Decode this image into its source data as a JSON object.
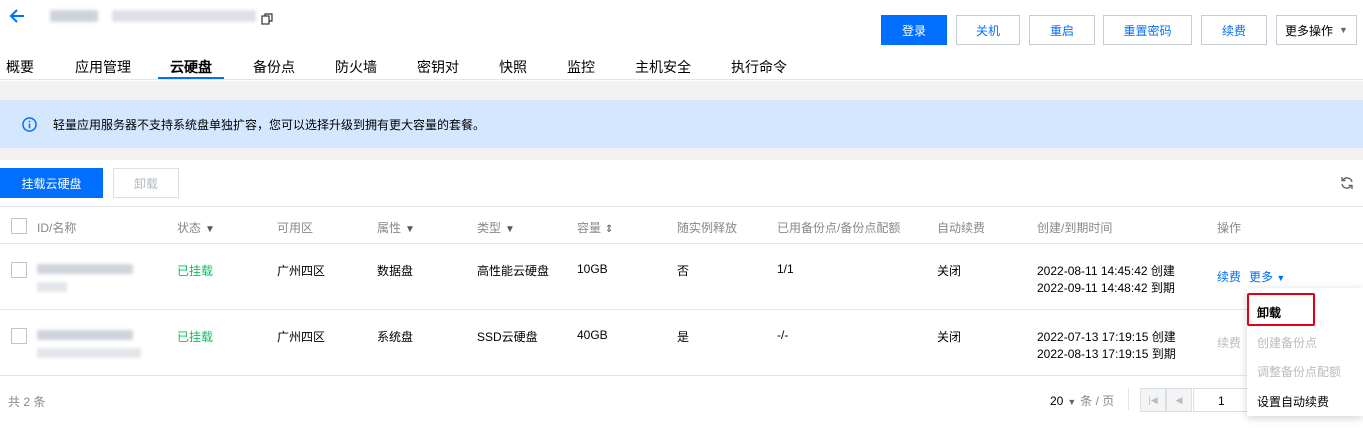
{
  "header": {
    "instance_name": "WOOC",
    "instance_ip": "广州 | (公) 106.53.141.195",
    "actions": {
      "login": "登录",
      "shutdown": "关机",
      "restart": "重启",
      "reset_password": "重置密码",
      "renew": "续费",
      "more": "更多操作"
    }
  },
  "tabs": [
    "概要",
    "应用管理",
    "云硬盘",
    "备份点",
    "防火墙",
    "密钥对",
    "快照",
    "监控",
    "主机安全",
    "执行命令"
  ],
  "active_tab": "云硬盘",
  "alert": {
    "text": "轻量应用服务器不支持系统盘单独扩容，您可以选择升级到拥有更大容量的套餐。"
  },
  "toolbar": {
    "mount_label": "挂载云硬盘",
    "unmount_label": "卸载"
  },
  "table": {
    "columns": {
      "id_name": "ID/名称",
      "status": "状态",
      "zone": "可用区",
      "attribute": "属性",
      "type": "类型",
      "capacity": "容量",
      "release": "随实例释放",
      "backup": "已用备份点/备份点配额",
      "auto_renew": "自动续费",
      "time": "创建/到期时间",
      "ops": "操作"
    },
    "rows": [
      {
        "id": "lhdisk-hdgsoxem",
        "name": "dxc1",
        "status": "已挂载",
        "zone": "广州四区",
        "attribute": "数据盘",
        "type": "高性能云硬盘",
        "capacity": "10GB",
        "release": "否",
        "backup": "1/1",
        "auto_renew": "关闭",
        "created": "2022-08-11 14:45:42 创建",
        "expires": "2022-09-11 14:48:42 到期",
        "renew_label": "续费",
        "more_label": "更多"
      },
      {
        "id": "lhdisk-5prfbaip",
        "name": "lhdisk-5prfbaip-...",
        "status": "已挂载",
        "zone": "广州四区",
        "attribute": "系统盘",
        "type": "SSD云硬盘",
        "capacity": "40GB",
        "release": "是",
        "backup": "-/-",
        "auto_renew": "关闭",
        "created": "2022-07-13 17:19:15 创建",
        "expires": "2022-08-13 17:19:15 到期",
        "renew_label": "续费"
      }
    ]
  },
  "pagination": {
    "total": "共 2 条",
    "page_size": "20",
    "per_page": "条 / 页",
    "current_page": "1"
  },
  "dropdown": {
    "items": [
      "卸载",
      "创建备份点",
      "调整备份点配额",
      "设置自动续费"
    ]
  },
  "colors": {
    "brand": "#006eff",
    "success": "#0abf5b",
    "alert_bg": "#d5e7ff",
    "highlight": "#e1001a"
  }
}
